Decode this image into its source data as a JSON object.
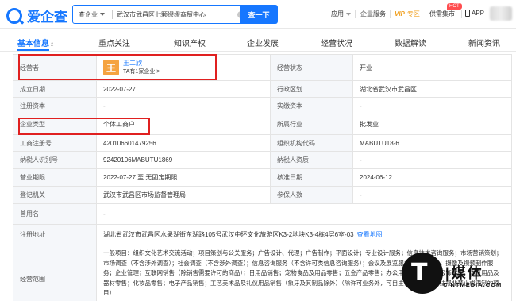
{
  "header": {
    "logo_text": "爱企查",
    "search_type": "查企业",
    "search_value": "武汉市武昌区七颗缪缪商贸中心",
    "search_button": "查一下",
    "nav": {
      "app": "应用",
      "enterprise": "企业服务",
      "vip": "VIP",
      "vip_sub": "专区",
      "supply": "供需集市",
      "hot": "HOT",
      "apk": "APP"
    }
  },
  "tabs": [
    {
      "label": "基本信息",
      "count": "2"
    },
    {
      "label": "重点关注"
    },
    {
      "label": "知识产权"
    },
    {
      "label": "企业发展"
    },
    {
      "label": "经营状况"
    },
    {
      "label": "数据解读"
    },
    {
      "label": "新闻资讯"
    }
  ],
  "info": {
    "operator_label": "经营者",
    "operator_avatar": "王",
    "operator_name": "王二欣",
    "operator_sub": "TA有1家企业 >",
    "status_label": "经营状态",
    "status_value": "开业",
    "founded_label": "成立日期",
    "founded_value": "2022-07-27",
    "region_label": "行政区划",
    "region_value": "湖北省武汉市武昌区",
    "reg_capital_label": "注册资本",
    "reg_capital_value": "-",
    "paid_capital_label": "实缴资本",
    "paid_capital_value": "-",
    "type_label": "企业类型",
    "type_value": "个体工商户",
    "industry_label": "所属行业",
    "industry_value": "批发业",
    "biz_reg_label": "工商注册号",
    "biz_reg_value": "420106601479256",
    "org_code_label": "组织机构代码",
    "org_code_value": "MABUTU18-6",
    "tax_id_label": "纳税人识别号",
    "tax_id_value": "92420106MABUTU1869",
    "tax_qual_label": "纳税人资质",
    "tax_qual_value": "-",
    "term_label": "营业期限",
    "term_value": "2022-07-27 至 无固定期限",
    "approve_label": "核准日期",
    "approve_value": "2024-06-12",
    "authority_label": "登记机关",
    "authority_value": "武汉市武昌区市场监督管理局",
    "insured_label": "参保人数",
    "insured_value": "-",
    "former_label": "曾用名",
    "former_value": "-",
    "address_label": "注册地址",
    "address_value": "湖北省武汉市武昌区水果湖街东湖路105号武汉中环文化旅游区K3-2地块K3-4栋4层6室-03",
    "address_link": "查看地图",
    "scope_label": "经营范围",
    "scope_value": "一般项目：组织文化艺术交流活动；项目策划与公关服务；广告设计、代理；广告制作；平面设计；专业设计服务；信息技术咨询服务；市场营销策划；市场调查（不含涉外调查）；社会调查（不含涉外调查）；信息咨询服务（不含许可类信息咨询服务）；会议及展览服务；文艺创作；摄像及视频制作服务；企业管理；互联网销售（除销售需要许可的商品）；日用品销售；宠物食品及用品零售；五金产品零售；办公用品销售；服装服饰零售；体育用品及器材零售；化妆品零售；电子产品销售；工艺美术品及礼仪用品销售（象牙及其制品除外）（除许可业务外，可自主依法经营法律法规非禁止或限制的项目）"
  },
  "watermark": {
    "glyph": "T",
    "text": "|媒体",
    "sub": "C.NTMEDIA.COM"
  }
}
